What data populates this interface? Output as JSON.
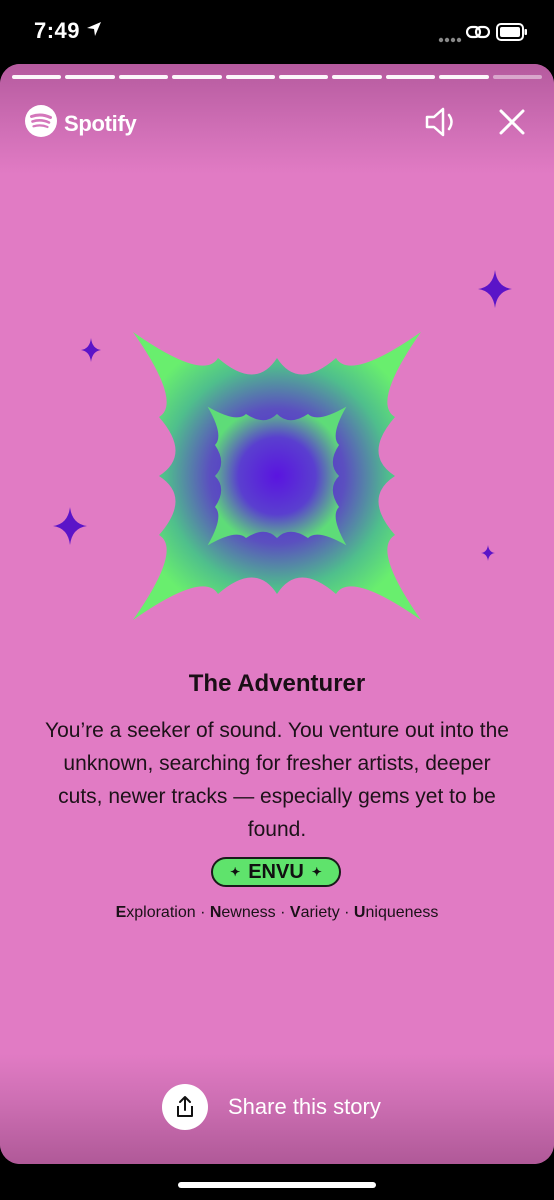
{
  "status_bar": {
    "time": "7:49",
    "icons": [
      "location-arrow-icon",
      "signal-dots-icon",
      "link-icon",
      "battery-icon"
    ]
  },
  "story": {
    "progress_segments": 10,
    "current_segment": 10,
    "brand": "Spotify",
    "background_color": "#e17bc4",
    "icons": [
      "spotify-logo-icon",
      "speaker-icon",
      "close-icon"
    ],
    "artwork": "burst-artwork",
    "title": "The Adventurer",
    "description": "You’re a seeker of sound. You venture out into the unknown, searching for fresher artists, deeper cuts, newer tracks — especially gems yet to be found.",
    "badge": "ENVU",
    "badge_color": "#5fe36c",
    "traits": [
      {
        "initial": "E",
        "rest": "xploration"
      },
      {
        "initial": "N",
        "rest": "ewness"
      },
      {
        "initial": "V",
        "rest": "ariety"
      },
      {
        "initial": "U",
        "rest": "niqueness"
      }
    ],
    "trait_separator": "·",
    "share_label": "Share this story",
    "share_icon": "share-icon"
  }
}
